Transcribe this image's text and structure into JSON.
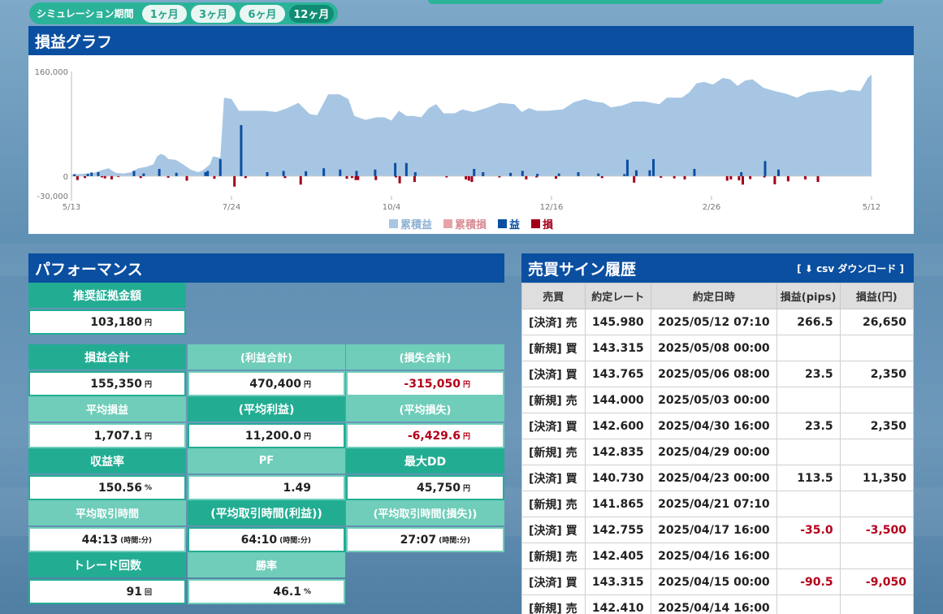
{
  "period": {
    "label": "シミュレーション期間",
    "options": [
      "1ヶ月",
      "3ヶ月",
      "6ヶ月",
      "12ヶ月"
    ],
    "selected": "12ヶ月"
  },
  "graph": {
    "title": "損益グラフ"
  },
  "chart_data": {
    "type": "bar",
    "x_ticks": [
      "5/13",
      "7/24",
      "10/4",
      "12/16",
      "2/26",
      "5/12"
    ],
    "y_ticks": [
      "160,000",
      "0",
      "-30,000"
    ],
    "ylim": [
      -30000,
      160000
    ],
    "legend": [
      "累積益",
      "累積損",
      "益",
      "損"
    ],
    "colors": {
      "cum_profit": "#a7c6e3",
      "cum_loss": "#e6a4aa",
      "profit": "#0b4fa1",
      "loss": "#a3001a"
    },
    "series": [
      {
        "name": "累積益",
        "type": "area",
        "points": [
          [
            0,
            2000
          ],
          [
            10,
            3000
          ],
          [
            20,
            4000
          ],
          [
            30,
            5000
          ],
          [
            40,
            9000
          ],
          [
            50,
            12000
          ],
          [
            55,
            8000
          ],
          [
            60,
            5000
          ],
          [
            70,
            4000
          ],
          [
            80,
            6000
          ],
          [
            90,
            12000
          ],
          [
            100,
            14000
          ],
          [
            110,
            18000
          ],
          [
            115,
            30000
          ],
          [
            120,
            34000
          ],
          [
            125,
            32000
          ],
          [
            130,
            26000
          ],
          [
            140,
            25000
          ],
          [
            150,
            18000
          ],
          [
            160,
            10000
          ],
          [
            170,
            6000
          ],
          [
            175,
            8000
          ],
          [
            180,
            12000
          ],
          [
            186,
            18000
          ],
          [
            190,
            30000
          ],
          [
            200,
            28000
          ],
          [
            205,
            120000
          ],
          [
            215,
            118000
          ],
          [
            225,
            100000
          ],
          [
            240,
            100000
          ],
          [
            260,
            100000
          ],
          [
            275,
            98000
          ],
          [
            290,
            104000
          ],
          [
            305,
            112000
          ],
          [
            320,
            95000
          ],
          [
            330,
            93000
          ],
          [
            345,
            125000
          ],
          [
            360,
            125000
          ],
          [
            372,
            118000
          ],
          [
            380,
            92000
          ],
          [
            395,
            86000
          ],
          [
            410,
            90000
          ],
          [
            420,
            90000
          ],
          [
            430,
            85000
          ],
          [
            440,
            100000
          ],
          [
            450,
            92000
          ],
          [
            460,
            92000
          ],
          [
            470,
            90000
          ],
          [
            480,
            104000
          ],
          [
            490,
            110000
          ],
          [
            500,
            96000
          ],
          [
            515,
            96000
          ],
          [
            525,
            102000
          ],
          [
            540,
            98000
          ],
          [
            560,
            105000
          ],
          [
            575,
            112000
          ],
          [
            595,
            110000
          ],
          [
            605,
            98000
          ],
          [
            615,
            104000
          ],
          [
            625,
            100000
          ],
          [
            640,
            100000
          ],
          [
            660,
            102000
          ],
          [
            675,
            113000
          ],
          [
            690,
            118000
          ],
          [
            702,
            114000
          ],
          [
            715,
            112000
          ],
          [
            725,
            105000
          ],
          [
            740,
            108000
          ],
          [
            755,
            114000
          ],
          [
            770,
            114000
          ],
          [
            790,
            110000
          ],
          [
            800,
            120000
          ],
          [
            820,
            120000
          ],
          [
            830,
            128000
          ],
          [
            840,
            142000
          ],
          [
            850,
            144000
          ],
          [
            862,
            140000
          ],
          [
            875,
            150000
          ],
          [
            885,
            148000
          ],
          [
            895,
            138000
          ],
          [
            905,
            146000
          ],
          [
            915,
            148000
          ],
          [
            930,
            135000
          ],
          [
            945,
            130000
          ],
          [
            960,
            126000
          ],
          [
            975,
            120000
          ],
          [
            990,
            128000
          ],
          [
            1005,
            130000
          ],
          [
            1020,
            132000
          ],
          [
            1035,
            128000
          ],
          [
            1045,
            132000
          ],
          [
            1060,
            130000
          ],
          [
            1070,
            150000
          ],
          [
            1075,
            155350
          ]
        ]
      },
      {
        "name": "益",
        "type": "bar",
        "bars": [
          [
            4,
            3000
          ],
          [
            22,
            3500
          ],
          [
            27,
            5500
          ],
          [
            36,
            6000
          ],
          [
            84,
            8000
          ],
          [
            97,
            4000
          ],
          [
            118,
            11000
          ],
          [
            141,
            5000
          ],
          [
            180,
            6000
          ],
          [
            183,
            8000
          ],
          [
            200,
            26000
          ],
          [
            228,
            78000
          ],
          [
            263,
            6000
          ],
          [
            285,
            8000
          ],
          [
            315,
            7500
          ],
          [
            339,
            12000
          ],
          [
            361,
            10000
          ],
          [
            383,
            8000
          ],
          [
            408,
            10000
          ],
          [
            435,
            20000
          ],
          [
            450,
            20000
          ],
          [
            462,
            6000
          ],
          [
            541,
            11000
          ],
          [
            553,
            6000
          ],
          [
            590,
            5000
          ],
          [
            606,
            8000
          ],
          [
            626,
            3500
          ],
          [
            655,
            4000
          ],
          [
            681,
            6000
          ],
          [
            708,
            4000
          ],
          [
            743,
            3000
          ],
          [
            747,
            25000
          ],
          [
            759,
            9000
          ],
          [
            777,
            9000
          ],
          [
            782,
            26000
          ],
          [
            837,
            11000
          ],
          [
            900,
            6000
          ],
          [
            932,
            23000
          ],
          [
            950,
            10000
          ]
        ]
      },
      {
        "name": "損",
        "type": "bar",
        "bars": [
          [
            8,
            -6000
          ],
          [
            18,
            -3000
          ],
          [
            41,
            -2000
          ],
          [
            45,
            -3500
          ],
          [
            54,
            -5000
          ],
          [
            63,
            -1200
          ],
          [
            93,
            -3000
          ],
          [
            130,
            -2500
          ],
          [
            155,
            -7000
          ],
          [
            192,
            -4000
          ],
          [
            219,
            -16000
          ],
          [
            234,
            -3000
          ],
          [
            287,
            -3000
          ],
          [
            308,
            -13000
          ],
          [
            370,
            -4000
          ],
          [
            377,
            -3000
          ],
          [
            382,
            -6000
          ],
          [
            385,
            -6000
          ],
          [
            409,
            -6000
          ],
          [
            436,
            -2000
          ],
          [
            441,
            -11000
          ],
          [
            461,
            -9000
          ],
          [
            504,
            -2000
          ],
          [
            530,
            -5000
          ],
          [
            534,
            -7000
          ],
          [
            538,
            -9000
          ],
          [
            575,
            -2000
          ],
          [
            611,
            -5000
          ],
          [
            625,
            -2000
          ],
          [
            651,
            -4000
          ],
          [
            713,
            -3000
          ],
          [
            756,
            -10000
          ],
          [
            792,
            -2500
          ],
          [
            810,
            -3500
          ],
          [
            824,
            -5000
          ],
          [
            881,
            -7000
          ],
          [
            886,
            -5000
          ],
          [
            897,
            -6500
          ],
          [
            902,
            -13000
          ],
          [
            912,
            -4500
          ],
          [
            931,
            -2000
          ],
          [
            945,
            -12500
          ],
          [
            963,
            -8000
          ],
          [
            986,
            -5000
          ],
          [
            1003,
            -9000
          ]
        ]
      }
    ]
  },
  "performance": {
    "title": "パフォーマンス",
    "recommended_margin": {
      "label": "推奨証拠金額",
      "value": "103,180",
      "unit": "円"
    },
    "rows": [
      [
        {
          "label": "損益合計",
          "value": "155,350",
          "unit": "円",
          "neg": false,
          "style": "dark"
        },
        {
          "label": "(利益合計)",
          "value": "470,400",
          "unit": "円",
          "neg": false,
          "style": "light"
        },
        {
          "label": "(損失合計)",
          "value": "-315,050",
          "unit": "円",
          "neg": true,
          "style": "light"
        }
      ],
      [
        {
          "label": "平均損益",
          "value": "1,707.1",
          "unit": "円",
          "neg": false,
          "style": "light"
        },
        {
          "label": "(平均利益)",
          "value": "11,200.0",
          "unit": "円",
          "neg": false,
          "style": "dark"
        },
        {
          "label": "(平均損失)",
          "value": "-6,429.6",
          "unit": "円",
          "neg": true,
          "style": "light"
        }
      ],
      [
        {
          "label": "収益率",
          "value": "150.56",
          "unit": "%",
          "neg": false,
          "style": "dark"
        },
        {
          "label": "PF",
          "value": "1.49",
          "unit": "",
          "neg": false,
          "style": "light"
        },
        {
          "label": "最大DD",
          "value": "45,750",
          "unit": "円",
          "neg": false,
          "style": "dark"
        }
      ],
      [
        {
          "label": "平均取引時間",
          "value": "44:13",
          "unit": "(時間:分)",
          "neg": false,
          "style": "light"
        },
        {
          "label": "(平均取引時間(利益))",
          "value": "64:10",
          "unit": "(時間:分)",
          "neg": false,
          "style": "dark"
        },
        {
          "label": "(平均取引時間(損失))",
          "value": "27:07",
          "unit": "(時間:分)",
          "neg": false,
          "style": "light"
        }
      ],
      [
        {
          "label": "トレード回数",
          "value": "91",
          "unit": "回",
          "neg": false,
          "style": "dark"
        },
        {
          "label": "勝率",
          "value": "46.1",
          "unit": "%",
          "neg": false,
          "style": "light"
        }
      ]
    ]
  },
  "trades": {
    "title": "売買サイン履歴",
    "csv_label": "[ ⬇ csv ダウンロード ]",
    "columns": [
      "売買",
      "約定レート",
      "約定日時",
      "損益(pips)",
      "損益(円)"
    ],
    "rows": [
      {
        "side": "[決済] 売",
        "rate": "145.980",
        "datetime": "2025/05/12 07:10",
        "pips": "266.5",
        "yen": "26,650",
        "neg": false
      },
      {
        "side": "[新規] 買",
        "rate": "143.315",
        "datetime": "2025/05/08 00:00",
        "pips": "",
        "yen": "",
        "neg": false
      },
      {
        "side": "[決済] 買",
        "rate": "143.765",
        "datetime": "2025/05/06 08:00",
        "pips": "23.5",
        "yen": "2,350",
        "neg": false
      },
      {
        "side": "[新規] 売",
        "rate": "144.000",
        "datetime": "2025/05/03 00:00",
        "pips": "",
        "yen": "",
        "neg": false
      },
      {
        "side": "[決済] 買",
        "rate": "142.600",
        "datetime": "2025/04/30 16:00",
        "pips": "23.5",
        "yen": "2,350",
        "neg": false
      },
      {
        "side": "[新規] 売",
        "rate": "142.835",
        "datetime": "2025/04/29 00:00",
        "pips": "",
        "yen": "",
        "neg": false
      },
      {
        "side": "[決済] 買",
        "rate": "140.730",
        "datetime": "2025/04/23 00:00",
        "pips": "113.5",
        "yen": "11,350",
        "neg": false
      },
      {
        "side": "[新規] 売",
        "rate": "141.865",
        "datetime": "2025/04/21 07:10",
        "pips": "",
        "yen": "",
        "neg": false
      },
      {
        "side": "[決済] 買",
        "rate": "142.755",
        "datetime": "2025/04/17 16:00",
        "pips": "-35.0",
        "yen": "-3,500",
        "neg": true
      },
      {
        "side": "[新規] 売",
        "rate": "142.405",
        "datetime": "2025/04/16 16:00",
        "pips": "",
        "yen": "",
        "neg": false
      },
      {
        "side": "[決済] 買",
        "rate": "143.315",
        "datetime": "2025/04/15 00:00",
        "pips": "-90.5",
        "yen": "-9,050",
        "neg": true
      },
      {
        "side": "[新規] 売",
        "rate": "142.410",
        "datetime": "2025/04/14 16:00",
        "pips": "",
        "yen": "",
        "neg": false
      }
    ]
  }
}
